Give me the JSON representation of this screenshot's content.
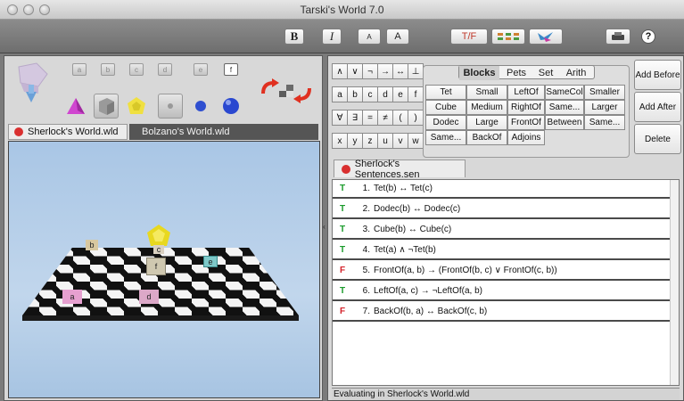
{
  "window": {
    "title": "Tarski's World 7.0"
  },
  "toolbar": {
    "bold": "B",
    "italic": "I",
    "font_small": "A",
    "font_large": "A",
    "truth_button": "T/F"
  },
  "palette": {
    "label_buttons": [
      "a",
      "b",
      "c",
      "d",
      "e",
      "f"
    ],
    "active_label": "f"
  },
  "world_tabs": [
    "Sherlock's World.wld",
    "Bolzano's World.wld"
  ],
  "world_blocks": [
    "a",
    "b",
    "c",
    "d",
    "e",
    "f"
  ],
  "keyboard": {
    "rows": [
      [
        "∧",
        "∨",
        "¬",
        "→",
        "↔",
        "⊥"
      ],
      [
        "a",
        "b",
        "c",
        "d",
        "e",
        "f"
      ],
      [
        "∀",
        "∃",
        "=",
        "≠",
        "(",
        ")"
      ],
      [
        "x",
        "y",
        "z",
        "u",
        "v",
        "w"
      ]
    ]
  },
  "predicate_tabs": [
    "Blocks",
    "Pets",
    "Set",
    "Arith"
  ],
  "predicates": [
    [
      "Tet",
      "Small",
      "LeftOf",
      "SameCol",
      "Smaller"
    ],
    [
      "Cube",
      "Medium",
      "RightOf",
      "Same...",
      "Larger"
    ],
    [
      "Dodec",
      "Large",
      "FrontOf",
      "Between",
      "Same..."
    ],
    [
      "Same...",
      "BackOf",
      "Adjoins"
    ]
  ],
  "side_buttons": {
    "add_before": "Add Before",
    "add_after": "Add After",
    "delete": "Delete"
  },
  "sentences_tab": "Sherlock's Sentences.sen",
  "sentences": [
    {
      "truth": "T",
      "num": "1.",
      "text": "Tet(b) ↔ Tet(c)"
    },
    {
      "truth": "T",
      "num": "2.",
      "text": "Dodec(b) ↔ Dodec(c)"
    },
    {
      "truth": "T",
      "num": "3.",
      "text": "Cube(b) ↔ Cube(c)"
    },
    {
      "truth": "T",
      "num": "4.",
      "text": "Tet(a) ∧ ¬Tet(b)"
    },
    {
      "truth": "F",
      "num": "5.",
      "text": "FrontOf(a, b) → (FrontOf(b, c) ∨ FrontOf(c, b))"
    },
    {
      "truth": "T",
      "num": "6.",
      "text": "LeftOf(a, c) → ¬LeftOf(a, b)"
    },
    {
      "truth": "F",
      "num": "7.",
      "text": "BackOf(b, a) ↔ BackOf(c, b)"
    }
  ],
  "status": "Evaluating in Sherlock's World.wld",
  "colors": {
    "true": "#1a9b2b",
    "false": "#d4222a"
  }
}
